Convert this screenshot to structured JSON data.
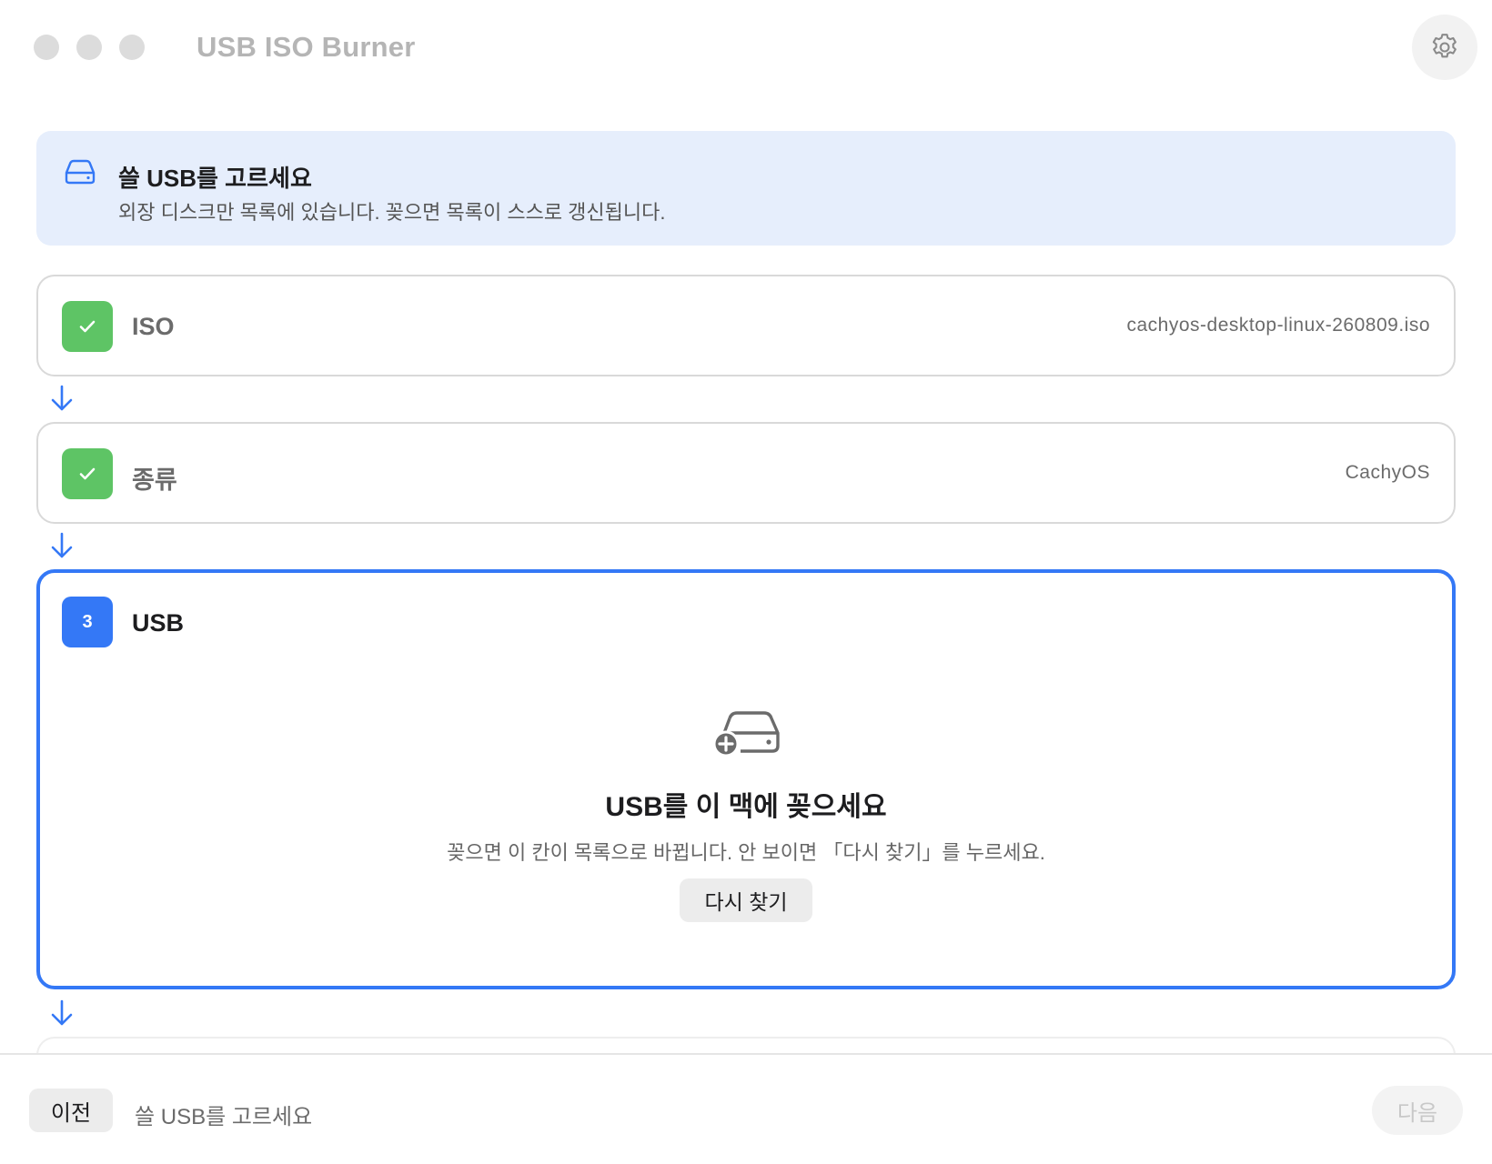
{
  "window": {
    "title": "USB ISO Burner",
    "settings_icon": "gear-icon"
  },
  "banner": {
    "icon": "external-drive-icon",
    "title": "쓸 USB를 고르세요",
    "subtitle": "외장 디스크만 목록에 있습니다. 꽂으면 목록이 스스로 갱신됩니다."
  },
  "steps": [
    {
      "status": "done",
      "badge_icon": "checkmark-icon",
      "label": "ISO",
      "value": "cachyos-desktop-linux-260809.iso"
    },
    {
      "status": "done",
      "badge_icon": "checkmark-icon",
      "label": "종류",
      "value": "CachyOS"
    },
    {
      "status": "active",
      "number": "3",
      "label": "USB"
    }
  ],
  "usb_empty_state": {
    "icon": "drive-add-icon",
    "title": "USB를 이 맥에 꽂으세요",
    "subtitle": "꽂으면 이 칸이 목록으로 바뀝니다. 안 보이면 「다시 찾기」를 누르세요.",
    "rescan_label": "다시 찾기"
  },
  "footer": {
    "prev_label": "이전",
    "status": "쓸 USB를 고르세요",
    "next_label": "다음",
    "next_enabled": false
  },
  "colors": {
    "accent": "#3478f6",
    "done": "#5ec465",
    "banner_bg": "#e6eefc"
  }
}
